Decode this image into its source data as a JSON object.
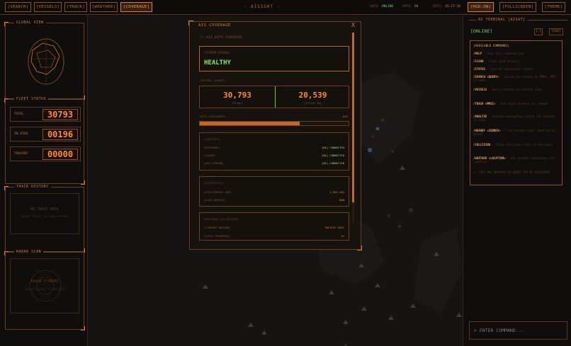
{
  "nav": {
    "buttons": [
      "[SEARCH]",
      "[VESSELS]",
      "[TRACK]",
      "[WEATHER]",
      "[COVERAGE]"
    ],
    "active": "[COVERAGE]",
    "brand": "◦ AISIGHT ◦",
    "status": [
      {
        "label": "[AIS]",
        "value": "ONLINE"
      },
      {
        "label": "[FPS]",
        "value": "60"
      },
      {
        "label": "[UTC]",
        "value": "15:27:16"
      }
    ],
    "right_buttons": [
      "[HUD:ON]",
      "[FULLSCREEN]",
      "[THEME]"
    ]
  },
  "left": {
    "global_view": {
      "title": "GLOBAL VIEW"
    },
    "fleet_status": {
      "title": "FLEET STATUS",
      "rows": [
        {
          "label": "TOTAL",
          "value": "30793"
        },
        {
          "label": "IN VIEW",
          "value": "00196"
        },
        {
          "label": "TRACKED",
          "value": "00000"
        }
      ]
    },
    "track_history": {
      "title": "TRACK HISTORY",
      "empty": "NO TRACK DATA",
      "hint": "SELECT VESSEL TO VIEW HISTORY"
    },
    "radar_scan": {
      "title": "RADAR SCAN",
      "empty": "RADAR STANDBY",
      "hint": "SELECT VESSEL TO ACTIVATE"
    }
  },
  "modal": {
    "title": "AIS COVERAGE",
    "close": "X",
    "subtitle": "// AIS DATA COVERAGE",
    "system_status_label": "[SYSTEM STATUS]",
    "system_status_value": "HEALTHY",
    "vessel_count_label": "[VESSEL COUNT]",
    "total_value": "30,793",
    "total_label": "[TOTAL]",
    "active_value": "20,539",
    "active_label": "[ACTIVE 1H]",
    "freshness_label": "DATA FRESHNESS",
    "freshness_pct_text": "67%",
    "freshness_fraction": 0.67,
    "services": {
      "heading": "[SERVICES]",
      "rows": [
        {
          "k": "[DATABASE]",
          "v": "[OK] CONNECTED"
        },
        {
          "k": "[CACHE]",
          "v": "[OK] CONNECTED"
        },
        {
          "k": "[AIS STREAM]",
          "v": "[OK] CONNECTED"
        }
      ]
    },
    "statistics": {
      "heading": "[STATISTICS]",
      "rows": [
        {
          "k": "[POS REPORTS 24H]",
          "v": "1,563,183"
        },
        {
          "k": "[LAST UPDATE]",
          "v": "NOW"
        }
      ]
    },
    "regional": {
      "heading": "[REGIONAL COLLECTION]",
      "rows": [
        {
          "k": "[CURRENT REGION]",
          "v": "PACIFIC EAST"
        },
        {
          "k": "[CYCLE PROGRESS]",
          "v": "5%"
        }
      ]
    }
  },
  "terminal": {
    "title": "AI TERMINAL [AISAT]",
    "status": "[ONLINE]",
    "buttons": [
      "[-]",
      "[CLR]"
    ],
    "commands_title": "[AVAILABLE COMMANDS]",
    "commands": [
      {
        "cmd": "/HELP",
        "desc": " - Show this command list"
      },
      {
        "cmd": "/CLEAR",
        "desc": " - Clear chat history"
      },
      {
        "cmd": "/STATUS",
        "desc": " - Show AI connection status"
      },
      {
        "cmd": "/SEARCH <QUERY>",
        "desc": " - Search for vessel by MMSI, IMO, or name"
      },
      {
        "cmd": "/VESSELS",
        "desc": " - Query vessels in current view"
      },
      {
        "cmd": "/TRACK <MMSI>",
        "desc": " - Get track history for vessel"
      },
      {
        "cmd": "/ANALYZE",
        "desc": " - Analyze navigation safety for vessels in view"
      },
      {
        "cmd": "/NEARBY <COORDS>",
        "desc": " - Find vessels near location or vessel"
      },
      {
        "cmd": "/COLLISION",
        "desc": " - Check collision risks in the area"
      },
      {
        "cmd": "/WEATHER <LOCATION>",
        "desc": " - Get weather conditions for location"
      }
    ],
    "footer": "// TYPE ANY MESSAGE TO QUERY THE AI ASSISTANT",
    "input_placeholder": "> ENTER COMMAND..."
  }
}
